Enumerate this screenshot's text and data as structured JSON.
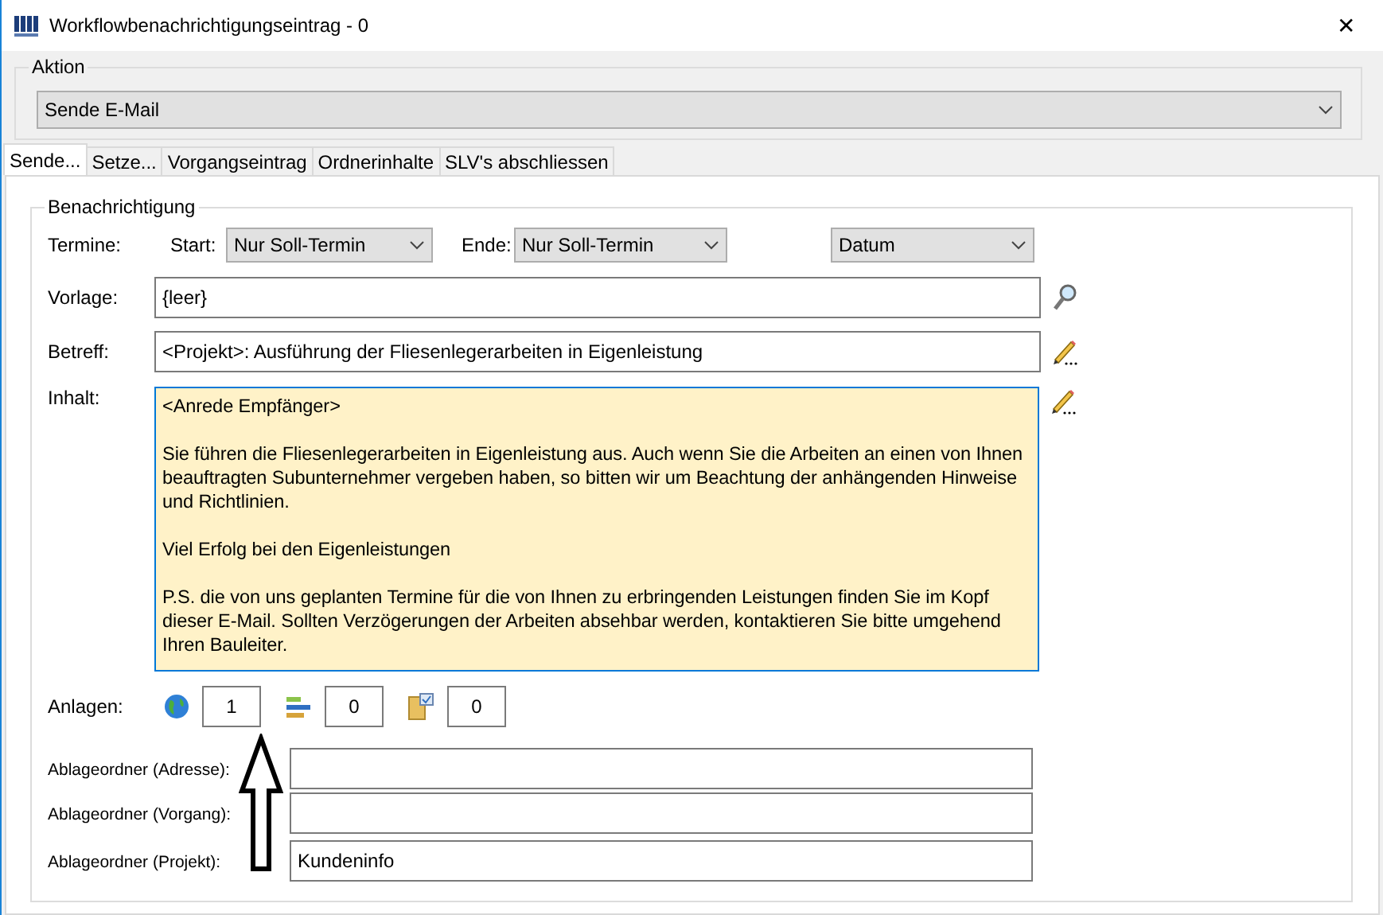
{
  "window": {
    "title": "Workflowbenachrichtigungseintrag - 0",
    "close": "✕"
  },
  "aktion": {
    "legend": "Aktion",
    "value": "Sende E-Mail"
  },
  "tabs": [
    {
      "label": "Sende...",
      "selected": true
    },
    {
      "label": "Setze...",
      "selected": false
    },
    {
      "label": "Vorgangseintrag",
      "selected": false
    },
    {
      "label": "Ordnerinhalte",
      "selected": false
    },
    {
      "label": "SLV's abschliessen",
      "selected": false
    }
  ],
  "benachrichtigung": {
    "legend": "Benachrichtigung",
    "termine": {
      "label": "Termine:",
      "start_label": "Start:",
      "start": "Nur Soll-Termin",
      "ende_label": "Ende:",
      "ende": "Nur Soll-Termin",
      "format": "Datum"
    },
    "vorlage": {
      "label": "Vorlage:",
      "value": "{leer}"
    },
    "betreff": {
      "label": "Betreff:",
      "value": "<Projekt>: Ausführung der Fliesenlegerarbeiten in Eigenleistung"
    },
    "inhalt": {
      "label": "Inhalt:",
      "paragraphs": [
        "<Anrede Empfänger>",
        "Sie führen die Fliesenlegerarbeiten in Eigenleistung aus. Auch wenn Sie die Arbeiten an einen von Ihnen beauftragten Subunternehmer vergeben haben, so bitten wir um Beachtung der anhängenden Hinweise und Richtlinien.",
        "Viel Erfolg bei den Eigenleistungen",
        "P.S. die von uns geplanten Termine für die von Ihnen zu erbringenden Leistungen finden Sie im Kopf dieser E-Mail. Sollten Verzögerungen der Arbeiten absehbar werden, kontaktieren Sie bitte umgehend Ihren Bauleiter."
      ]
    },
    "anlagen": {
      "label": "Anlagen:",
      "counts": [
        {
          "kind": "globe",
          "value": "1"
        },
        {
          "kind": "bars",
          "value": "0"
        },
        {
          "kind": "folder",
          "value": "0"
        }
      ]
    },
    "ablageordner": [
      {
        "label": "Ablageordner (Adresse):"
      },
      {
        "label": "Ablageordner (Vorgang):"
      },
      {
        "label": "Ablageordner (Projekt):",
        "value": "Kundeninfo"
      }
    ]
  }
}
